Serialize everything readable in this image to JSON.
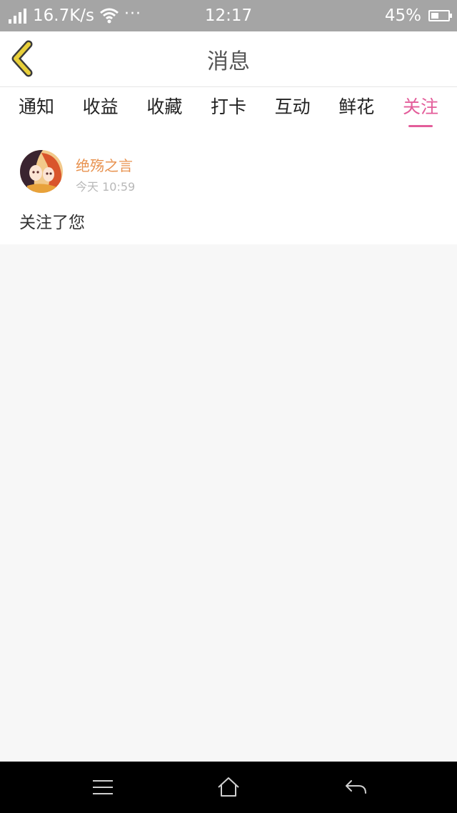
{
  "status_bar": {
    "network_speed": "16.7K/s",
    "more": "···",
    "time": "12:17",
    "battery": "45%",
    "battery_level": 0.45,
    "icons": [
      "signal-icon",
      "wifi-icon",
      "battery-icon"
    ]
  },
  "header": {
    "title": "消息",
    "back_icon": "chevron-left-icon",
    "accent_color": "#e8cf3a"
  },
  "tabs": [
    {
      "label": "通知",
      "active": false
    },
    {
      "label": "收益",
      "active": false
    },
    {
      "label": "收藏",
      "active": false
    },
    {
      "label": "打卡",
      "active": false
    },
    {
      "label": "互动",
      "active": false
    },
    {
      "label": "鲜花",
      "active": false
    },
    {
      "label": "关注",
      "active": true
    }
  ],
  "active_tab_color": "#e35d9a",
  "messages": [
    {
      "username": "绝殇之言",
      "timestamp": "今天 10:59",
      "text": "关注了您",
      "avatar": "avatar-image",
      "username_color": "#e8924f"
    }
  ],
  "nav_bar": {
    "icons": [
      "menu-icon",
      "home-icon",
      "back-arrow-icon"
    ]
  }
}
